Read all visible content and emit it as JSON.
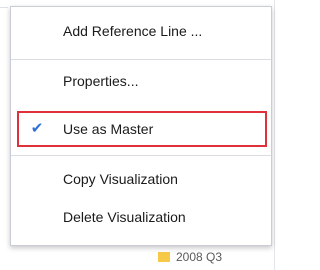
{
  "menu": {
    "items": [
      {
        "label": "Add Reference Line ...",
        "checked": false
      },
      {
        "label": "Properties...",
        "checked": false
      },
      {
        "label": "Use as Master",
        "checked": true
      },
      {
        "label": "Copy Visualization",
        "checked": false
      },
      {
        "label": "Delete Visualization",
        "checked": false
      }
    ],
    "check_glyph": "✔",
    "check_color": "#2f6fd6",
    "highlight_border_color": "#e0303a"
  },
  "background": {
    "legend_label": "2008 Q3",
    "legend_swatch_color": "#f7c948"
  }
}
